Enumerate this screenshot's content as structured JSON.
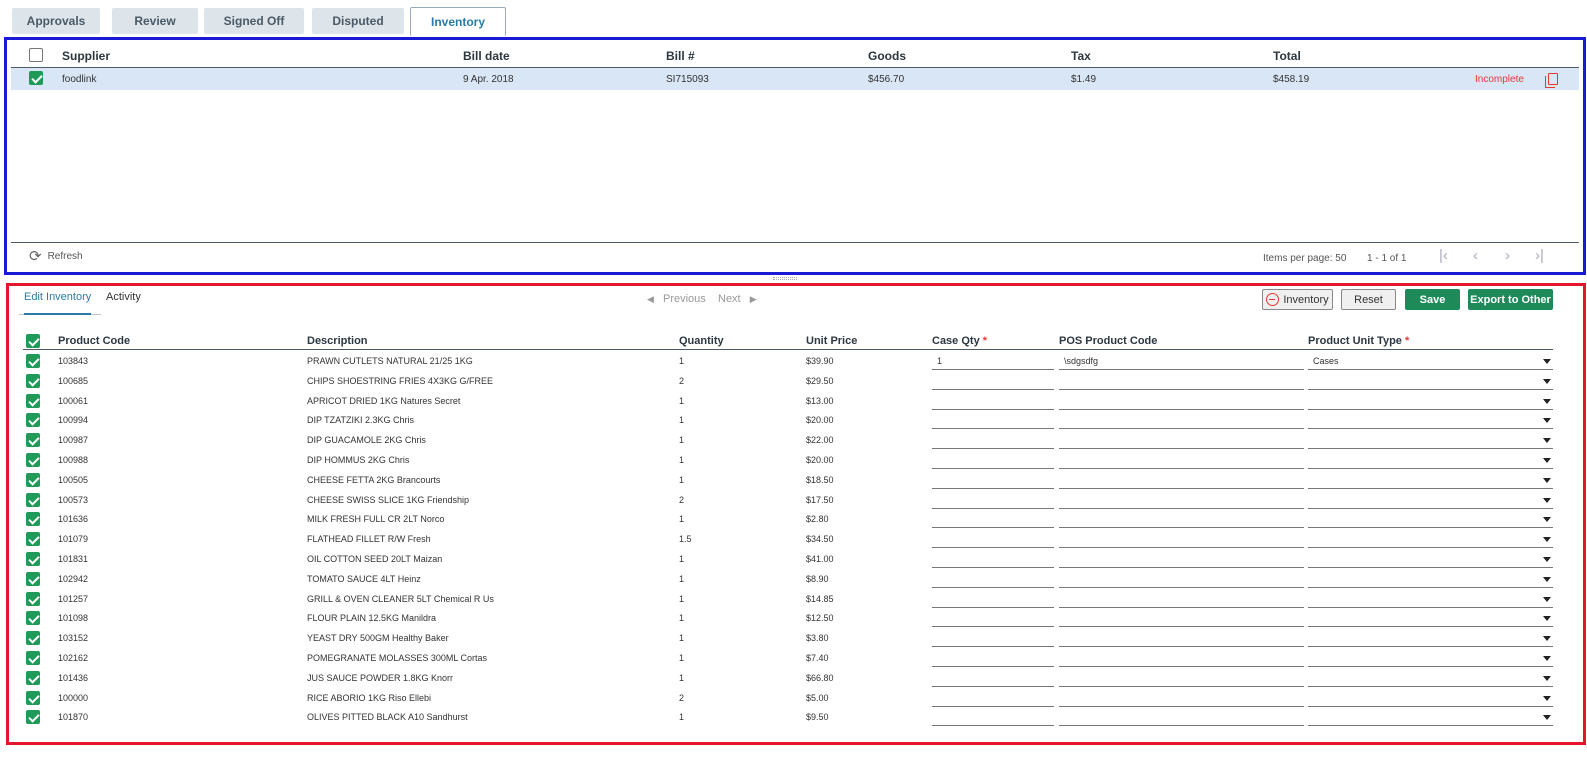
{
  "tabs": [
    "Approvals",
    "Review",
    "Signed Off",
    "Disputed",
    "Inventory"
  ],
  "bills": {
    "headers": {
      "supplier": "Supplier",
      "bill_date": "Bill date",
      "bill_no": "Bill #",
      "goods": "Goods",
      "tax": "Tax",
      "total": "Total"
    },
    "rows": [
      {
        "supplier": "foodlink",
        "bill_date": "9 Apr. 2018",
        "bill_no": "SI715093",
        "goods": "$456.70",
        "tax": "$1.49",
        "total": "$458.19",
        "status": "Incomplete"
      }
    ],
    "footer": {
      "refresh": "Refresh",
      "items_per_page": "Items per page:  50",
      "range": "1 - 1 of 1"
    }
  },
  "lines": {
    "subtabs": [
      "Edit Inventory",
      "Activity"
    ],
    "nav": {
      "previous": "Previous",
      "next": "Next"
    },
    "buttons": {
      "inventory": "Inventory",
      "reset": "Reset",
      "save": "Save",
      "export": "Export to Other"
    },
    "headers": {
      "code": "Product Code",
      "description": "Description",
      "quantity": "Quantity",
      "unit_price": "Unit Price",
      "case_qty": "Case Qty",
      "pos_code": "POS Product Code",
      "unit_type": "Product Unit Type",
      "required_mark": "*"
    },
    "rows": [
      {
        "code": "103843",
        "description": "PRAWN CUTLETS NATURAL 21/25 1KG",
        "quantity": "1",
        "unit_price": "$39.90",
        "case_qty": "1",
        "pos_code": "\\sdgsdfg",
        "unit_type": "Cases"
      },
      {
        "code": "100685",
        "description": "CHIPS SHOESTRING FRIES 4X3KG G/FREE",
        "quantity": "2",
        "unit_price": "$29.50",
        "case_qty": "",
        "pos_code": "",
        "unit_type": ""
      },
      {
        "code": "100061",
        "description": "APRICOT DRIED 1KG Natures Secret",
        "quantity": "1",
        "unit_price": "$13.00",
        "case_qty": "",
        "pos_code": "",
        "unit_type": ""
      },
      {
        "code": "100994",
        "description": "DIP TZATZIKI 2.3KG Chris",
        "quantity": "1",
        "unit_price": "$20.00",
        "case_qty": "",
        "pos_code": "",
        "unit_type": ""
      },
      {
        "code": "100987",
        "description": "DIP GUACAMOLE 2KG Chris",
        "quantity": "1",
        "unit_price": "$22.00",
        "case_qty": "",
        "pos_code": "",
        "unit_type": ""
      },
      {
        "code": "100988",
        "description": "DIP HOMMUS 2KG Chris",
        "quantity": "1",
        "unit_price": "$20.00",
        "case_qty": "",
        "pos_code": "",
        "unit_type": ""
      },
      {
        "code": "100505",
        "description": "CHEESE FETTA 2KG Brancourts",
        "quantity": "1",
        "unit_price": "$18.50",
        "case_qty": "",
        "pos_code": "",
        "unit_type": ""
      },
      {
        "code": "100573",
        "description": "CHEESE SWISS SLICE 1KG Friendship",
        "quantity": "2",
        "unit_price": "$17.50",
        "case_qty": "",
        "pos_code": "",
        "unit_type": ""
      },
      {
        "code": "101636",
        "description": "MILK FRESH FULL CR 2LT Norco",
        "quantity": "1",
        "unit_price": "$2.80",
        "case_qty": "",
        "pos_code": "",
        "unit_type": ""
      },
      {
        "code": "101079",
        "description": "FLATHEAD FILLET R/W Fresh",
        "quantity": "1.5",
        "unit_price": "$34.50",
        "case_qty": "",
        "pos_code": "",
        "unit_type": ""
      },
      {
        "code": "101831",
        "description": "OIL COTTON SEED 20LT Maizan",
        "quantity": "1",
        "unit_price": "$41.00",
        "case_qty": "",
        "pos_code": "",
        "unit_type": ""
      },
      {
        "code": "102942",
        "description": "TOMATO SAUCE 4LT Heinz",
        "quantity": "1",
        "unit_price": "$8.90",
        "case_qty": "",
        "pos_code": "",
        "unit_type": ""
      },
      {
        "code": "101257",
        "description": "GRILL & OVEN CLEANER 5LT Chemical R Us",
        "quantity": "1",
        "unit_price": "$14.85",
        "case_qty": "",
        "pos_code": "",
        "unit_type": ""
      },
      {
        "code": "101098",
        "description": "FLOUR PLAIN 12.5KG Manildra",
        "quantity": "1",
        "unit_price": "$12.50",
        "case_qty": "",
        "pos_code": "",
        "unit_type": ""
      },
      {
        "code": "103152",
        "description": "YEAST DRY 500GM Healthy Baker",
        "quantity": "1",
        "unit_price": "$3.80",
        "case_qty": "",
        "pos_code": "",
        "unit_type": ""
      },
      {
        "code": "102162",
        "description": "POMEGRANATE MOLASSES 300ML Cortas",
        "quantity": "1",
        "unit_price": "$7.40",
        "case_qty": "",
        "pos_code": "",
        "unit_type": ""
      },
      {
        "code": "101436",
        "description": "JUS SAUCE POWDER 1.8KG Knorr",
        "quantity": "1",
        "unit_price": "$66.80",
        "case_qty": "",
        "pos_code": "",
        "unit_type": ""
      },
      {
        "code": "100000",
        "description": "RICE ABORIO 1KG Riso Ellebi",
        "quantity": "2",
        "unit_price": "$5.00",
        "case_qty": "",
        "pos_code": "",
        "unit_type": ""
      },
      {
        "code": "101870",
        "description": "OLIVES PITTED BLACK A10 Sandhurst",
        "quantity": "1",
        "unit_price": "$9.50",
        "case_qty": "",
        "pos_code": "",
        "unit_type": ""
      }
    ]
  },
  "colors": {
    "accent": "#2b7ba6",
    "green": "#1e8a5a",
    "error": "#e53935",
    "selected_row": "#d9e6f5"
  }
}
